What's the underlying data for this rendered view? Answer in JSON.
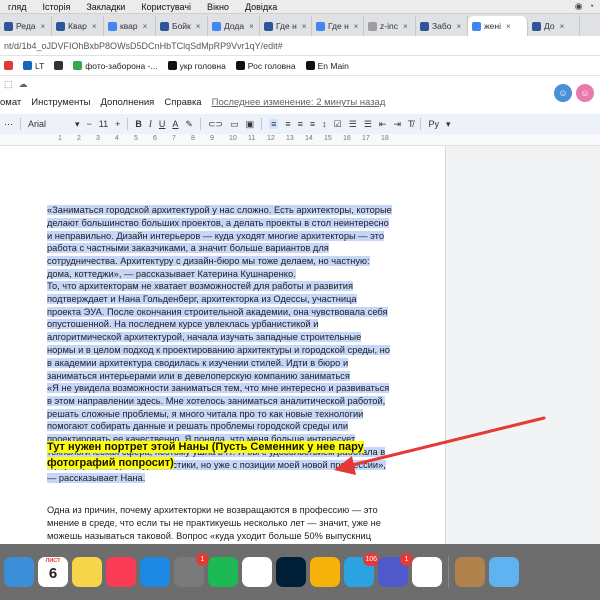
{
  "menubar": {
    "items": [
      "гляд",
      "Історія",
      "Закладки",
      "Користувачі",
      "Вікно",
      "Довідка"
    ]
  },
  "tabs": [
    {
      "label": "Реда",
      "icon": "word-doc-icon",
      "color": "#2b579a"
    },
    {
      "label": "Квар",
      "icon": "word-doc-icon",
      "color": "#2b579a"
    },
    {
      "label": "квар",
      "icon": "google-docs-icon",
      "color": "#4285f4"
    },
    {
      "label": "Бойк",
      "icon": "word-doc-icon",
      "color": "#2b579a"
    },
    {
      "label": "Дода",
      "icon": "google-docs-icon",
      "color": "#4285f4"
    },
    {
      "label": "Где н",
      "icon": "word-doc-icon",
      "color": "#2b579a"
    },
    {
      "label": "Где н",
      "icon": "google-docs-icon",
      "color": "#4285f4"
    },
    {
      "label": "z-inc",
      "icon": "site-icon",
      "color": "#9e9e9e"
    },
    {
      "label": "Забо",
      "icon": "word-doc-icon",
      "color": "#2b579a"
    },
    {
      "label": "жені",
      "icon": "google-docs-icon",
      "color": "#4285f4",
      "active": true
    },
    {
      "label": "До",
      "icon": "word-doc-icon",
      "color": "#2b579a"
    }
  ],
  "address": {
    "url": "nt/d/1b4_oJDVFIOhBxbP8OWsD5DCnHbTClqSdMpRP9Vvr1qY/edit#"
  },
  "bookmarks": [
    {
      "label": "",
      "icon": "calendar-bookmark-icon",
      "color": "#e53935"
    },
    {
      "label": "LT",
      "icon": "lt-icon",
      "color": "#1565c0"
    },
    {
      "label": "",
      "icon": "wave-icon",
      "color": "#333333"
    },
    {
      "label": "фото-заборона -...",
      "icon": "google-drive-icon",
      "color": "#34a853"
    },
    {
      "label": "укр головна",
      "icon": "black-square-icon",
      "color": "#111111"
    },
    {
      "label": "Рос головна",
      "icon": "black-square-icon",
      "color": "#111111"
    },
    {
      "label": "En Main",
      "icon": "black-square-icon",
      "color": "#111111"
    }
  ],
  "docs": {
    "menus": [
      "омат",
      "Инструменты",
      "Дополнения",
      "Справка"
    ],
    "last_edit": "Последнее изменение: 2 минуты назад"
  },
  "toolbar": {
    "font": "Arial",
    "size": "11",
    "bold": "B",
    "italic": "I",
    "underline": "U",
    "text_color": "A",
    "input_tools": "Рy"
  },
  "ruler": {
    "marks": [
      "1",
      "2",
      "3",
      "4",
      "5",
      "6",
      "7",
      "8",
      "9",
      "10",
      "11",
      "12",
      "13",
      "14",
      "15",
      "16",
      "17",
      "18"
    ]
  },
  "document": {
    "p1": "«Заниматься городской архитектурой у нас сложно. Есть архитекторы, которые делают большинство больших проектов, а делать проекты в стол неинтересно и неправильно. Дизайн интерьеров — куда уходят многие архитекторы — это работа с частными заказчиками, а значит больше вариантов для сотрудничества. Архитектуру с дизайн-бюро мы тоже делаем, но частную: дома, коттеджи», — рассказывает Катерина Кушнаренко.",
    "p2": "То, что архитекторам не хватает возможностей для работы и развития подтверждает и Нана Гольденберг, архитекторка из Одессы, участница проекта ЭУА. После окончания строительной академии, она чувствовала себя опустошенной. На последнем курсе увлеклась урбанистикой и алгоритмической архитектурой, начала изучать западные строительные нормы и в целом подход к проектированию архитектуры и городской среды, но в академии архитектура сводилась к изучении стилей. Идти в бюро и заниматься интерьерами или в девелоперскую компанию заниматься чертежами ей не хотелось.",
    "p3": "«Я не увидела возможности заниматься тем, что мне интересно и развиваться в этом направлении здесь. Мне хотелось заниматься аналитической работой, решать сложные проблемы, я много читала про то как новые технологии помогают собирать данные и решать проблемы городской среды или проектировать ее качественно. Я поняла, что меня больше интересует технологическая сфера, поэтому ушла в IT. Я бы с удовольствием работала в сфере архитектуры и урбанистики, но уже с позиции моей новой профессии», — рассказывает Нана.",
    "highlight": "Тут нужен портрет этой Наны (Пусть Семенник у нее пару фотографий попросит)",
    "p4": "Одна из причин, почему архитекторки не возвращаются в профессию — это мнение в среде, что если ты не практикуешь несколько лет — значит, уже не можешь называться таковой. Вопрос «куда уходит больше 50% выпускниц архитектурных"
  },
  "dock": {
    "calendar_month": "ЛИСТ",
    "calendar_day": "6",
    "apps": [
      {
        "icon": "finder-icon",
        "color": "#3b8fd9"
      },
      {
        "icon": "calendar-icon",
        "color": "#ffffff"
      },
      {
        "icon": "notes-icon",
        "color": "#f7d54a"
      },
      {
        "icon": "music-icon",
        "color": "#fa3b55"
      },
      {
        "icon": "app-store-icon",
        "color": "#1e88e5"
      },
      {
        "icon": "system-preferences-icon",
        "color": "#7a7a7a",
        "badge": "1"
      },
      {
        "icon": "spotify-icon",
        "color": "#1db954"
      },
      {
        "icon": "chrome-icon",
        "color": "#ffffff"
      },
      {
        "icon": "photoshop-icon",
        "color": "#001e36"
      },
      {
        "icon": "lightning-icon",
        "color": "#f6b20b"
      },
      {
        "icon": "telegram-icon",
        "color": "#2aa3e0",
        "badge": "106"
      },
      {
        "icon": "teams-icon",
        "color": "#5059c9",
        "badge": "1"
      },
      {
        "icon": "monday-icon",
        "color": "#ffffff"
      },
      {
        "icon": "archive-icon",
        "color": "#b0834a"
      },
      {
        "icon": "finder-folder-icon",
        "color": "#5fb3f0"
      }
    ]
  },
  "colors": {
    "selection": "#c6d6f9",
    "highlight": "#ffff00",
    "arrow": "#e53935"
  }
}
